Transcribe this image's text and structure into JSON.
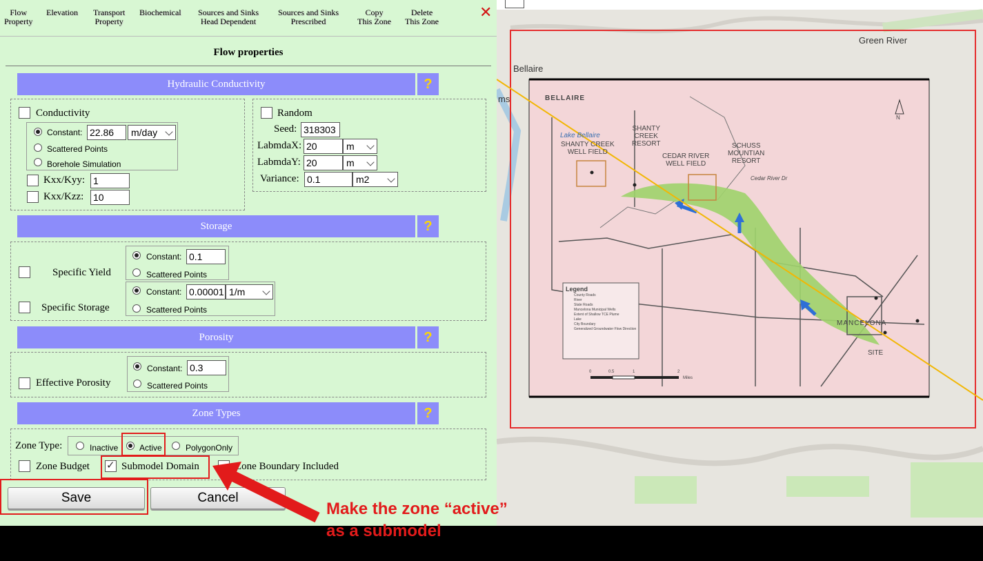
{
  "menu": [
    {
      "label": "Flow\nProperty"
    },
    {
      "label": "Elevation"
    },
    {
      "label": "Transport\nProperty"
    },
    {
      "label": "Biochemical"
    },
    {
      "label": "Sources and Sinks\nHead Dependent"
    },
    {
      "label": "Sources and Sinks\nPrescribed"
    },
    {
      "label": "Copy\nThis Zone"
    },
    {
      "label": "Delete\nThis Zone"
    }
  ],
  "close_glyph": "✕",
  "page_title": "Flow properties",
  "help_glyph": "?",
  "hydraulic": {
    "header": "Hydraulic Conductivity",
    "conductivity_label": "Conductivity",
    "constant_label": "Constant:",
    "constant_value": "22.86",
    "unit": "m/day",
    "scattered_label": "Scattered Points",
    "borehole_label": "Borehole Simulation",
    "kxx_kyy_label": "Kxx/Kyy:",
    "kxx_kyy_value": "1",
    "kxx_kzz_label": "Kxx/Kzz:",
    "kxx_kzz_value": "10",
    "random_label": "Random",
    "seed_label": "Seed:",
    "seed_value": "318303",
    "lambdax_label": "LabmdaX:",
    "lambdax_value": "20",
    "lambdax_unit": "m",
    "lambday_label": "LabmdaY:",
    "lambday_value": "20",
    "lambday_unit": "m",
    "variance_label": "Variance:",
    "variance_value": "0.1",
    "variance_unit": "m2"
  },
  "storage": {
    "header": "Storage",
    "specific_yield_label": "Specific Yield",
    "sy_constant_label": "Constant:",
    "sy_constant_value": "0.1",
    "sy_scattered_label": "Scattered Points",
    "ss_constant_label": "Constant:",
    "ss_constant_value": "0.00001",
    "ss_unit": "1/m",
    "ss_scattered_label": "Scattered Points",
    "specific_storage_label": "Specific Storage"
  },
  "porosity": {
    "header": "Porosity",
    "effective_label": "Effective Porosity",
    "constant_label": "Constant:",
    "constant_value": "0.3",
    "scattered_label": "Scattered Points"
  },
  "zone": {
    "header": "Zone Types",
    "zone_type_label": "Zone Type:",
    "inactive_label": "Inactive",
    "active_label": "Active",
    "polygon_label": "PolygonOnly",
    "budget_label": "Zone Budget",
    "submodel_label": "Submodel Domain",
    "boundary_label": "Zone Boundary Included"
  },
  "buttons": {
    "save": "Save",
    "cancel": "Cancel"
  },
  "annotation": {
    "line1": "Make the zone “active”",
    "line2": "as a submodel"
  },
  "map": {
    "green_river": "Green River",
    "bellaire": "Bellaire",
    "ms": "ms",
    "lake_bellaire": "Lake Bellaire",
    "bellaire_inset": "BELLAIRE",
    "shanty_creek_well": "SHANTY CREEK\nWELL FIELD",
    "shanty_creek_resort": "SHANTY\nCREEK\nRESORT",
    "cedar_river_well": "CEDAR RIVER\nWELL FIELD",
    "schuss": "SCHUSS\nMOUNTIAN\nRESORT",
    "cedar_river_dr": "Cedar River Dr",
    "mancelona": "MANCELONA",
    "site": "SITE",
    "north": "N",
    "legend_title": "Legend",
    "legend_items": [
      "County Roads",
      "River",
      "State Roads",
      "Mancelona Municipal Wells",
      "Extent of Shallow TCE Plume",
      "Lake",
      "City Boundary",
      "Generalized Groundwater Flow Direction"
    ],
    "scale_labels": [
      "0",
      "0.5",
      "1",
      "2",
      "Miles"
    ],
    "colors": {
      "plume": "#9fd36b",
      "arrow": "#2e6fd6",
      "zone_outline": "#e52d2d",
      "line": "#f2b705",
      "inset": "#f3d6d8"
    }
  }
}
